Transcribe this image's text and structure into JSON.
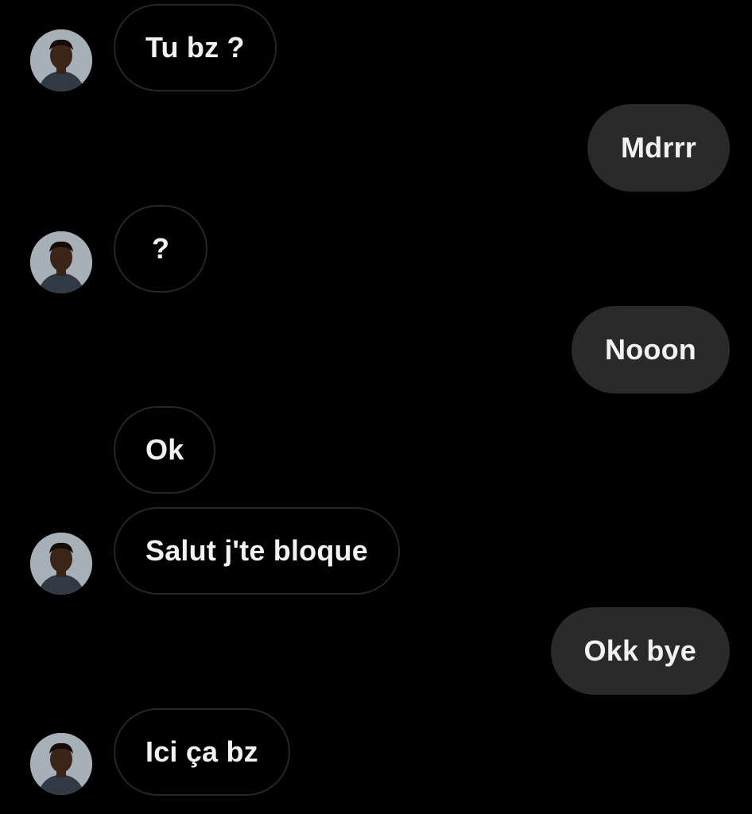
{
  "conversation": {
    "messages": [
      {
        "text": "Tu bz ?",
        "sender": "them",
        "avatar": true
      },
      {
        "text": "Mdrrr",
        "sender": "me"
      },
      {
        "text": "?",
        "sender": "them",
        "avatar": true
      },
      {
        "text": "Nooon",
        "sender": "me"
      },
      {
        "text": "Ok",
        "sender": "them",
        "avatar": false
      },
      {
        "text": "Salut j'te bloque",
        "sender": "them",
        "avatar": true
      },
      {
        "text": "Okk bye",
        "sender": "me"
      },
      {
        "text": "Ici ça bz",
        "sender": "them",
        "avatar": true
      }
    ]
  },
  "colors": {
    "background": "#000000",
    "sent_bubble": "#2a2a2a",
    "received_border": "#262626",
    "text": "#f2f2f2"
  },
  "icons": {
    "contact_avatar": "contact-avatar-photo"
  }
}
